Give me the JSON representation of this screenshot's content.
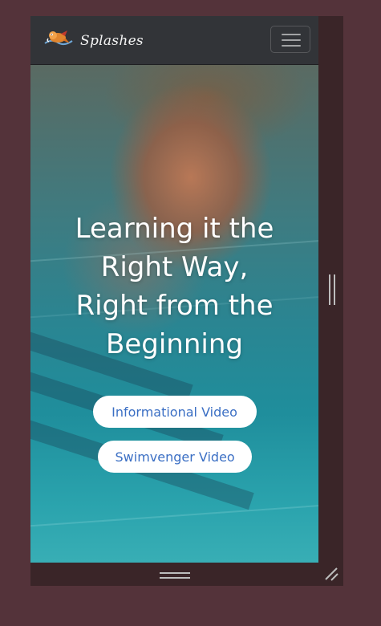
{
  "navbar": {
    "brand_name": "Splashes",
    "logo_icon": "swimmer-mascot-icon",
    "menu_icon": "hamburger-icon"
  },
  "hero": {
    "title_lines": [
      "Learning it the",
      "Right Way,",
      "Right from the",
      "Beginning"
    ],
    "buttons": {
      "informational": "Informational Video",
      "swimvenger": "Swimvenger Video"
    }
  },
  "colors": {
    "page_background": "#54333a",
    "navbar": "#323438",
    "button_text": "#3b6fc4",
    "button_background": "#ffffff"
  },
  "frame": {
    "side_handle_icon": "resize-handle-vertical-icon",
    "bottom_handle_icon": "resize-handle-horizontal-icon",
    "corner_icon": "resize-corner-icon"
  }
}
